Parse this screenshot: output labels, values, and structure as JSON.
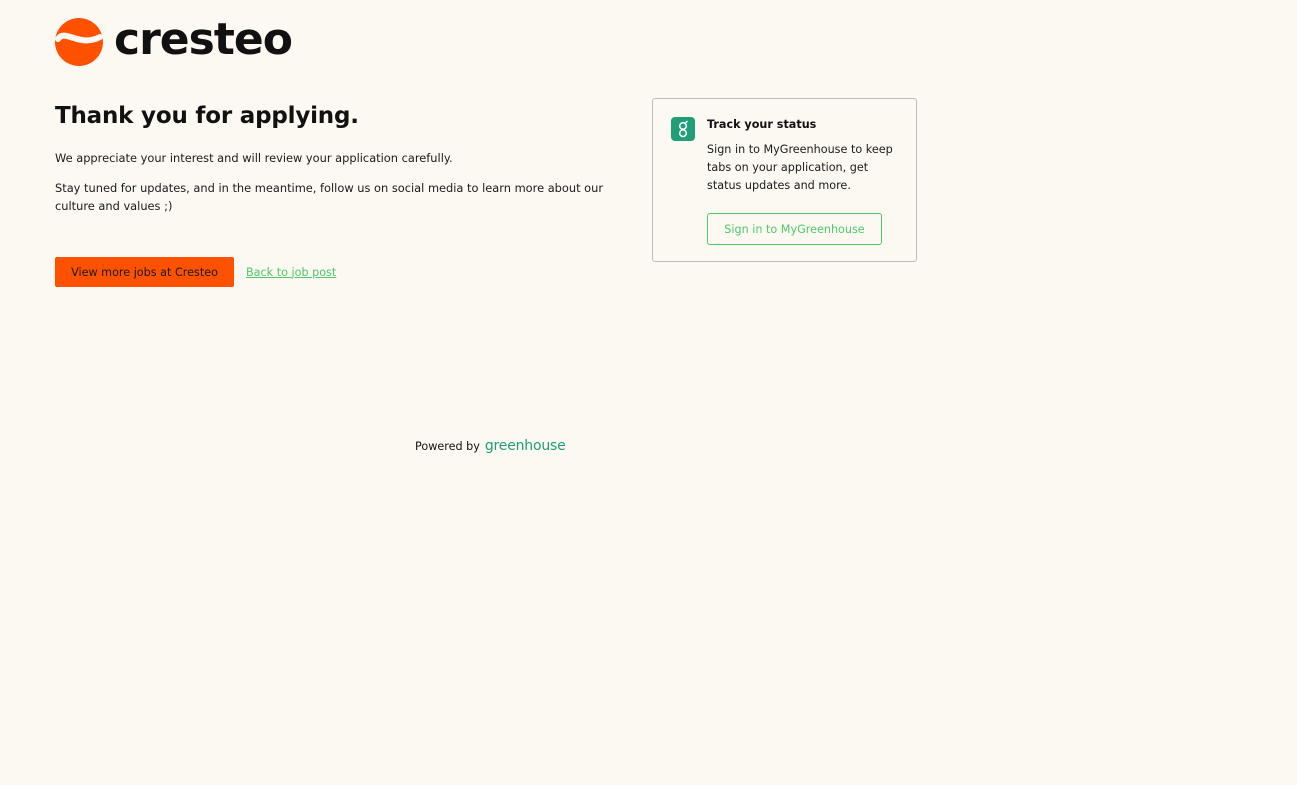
{
  "header": {
    "brand_name": "cresteo",
    "brand_color": "#ff5100"
  },
  "confirmation": {
    "title": "Thank you for applying.",
    "paragraph_1": "We appreciate your interest and will review your application carefully.",
    "paragraph_2": "Stay tuned for updates, and in the meantime, follow us on social media to learn more about our culture and values ;)",
    "view_jobs_label": "View more jobs at Cresteo",
    "back_link_label": "Back to job post"
  },
  "track_card": {
    "icon": "greenhouse-g-icon",
    "title": "Track your status",
    "description": "Sign in to MyGreenhouse to keep tabs on your application, get status updates and more.",
    "sign_in_label": "Sign in to MyGreenhouse",
    "accent_color": "#4ec96a"
  },
  "footer": {
    "powered_by": "Powered by",
    "provider_name": "greenhouse",
    "provider_color": "#1f9e77"
  }
}
